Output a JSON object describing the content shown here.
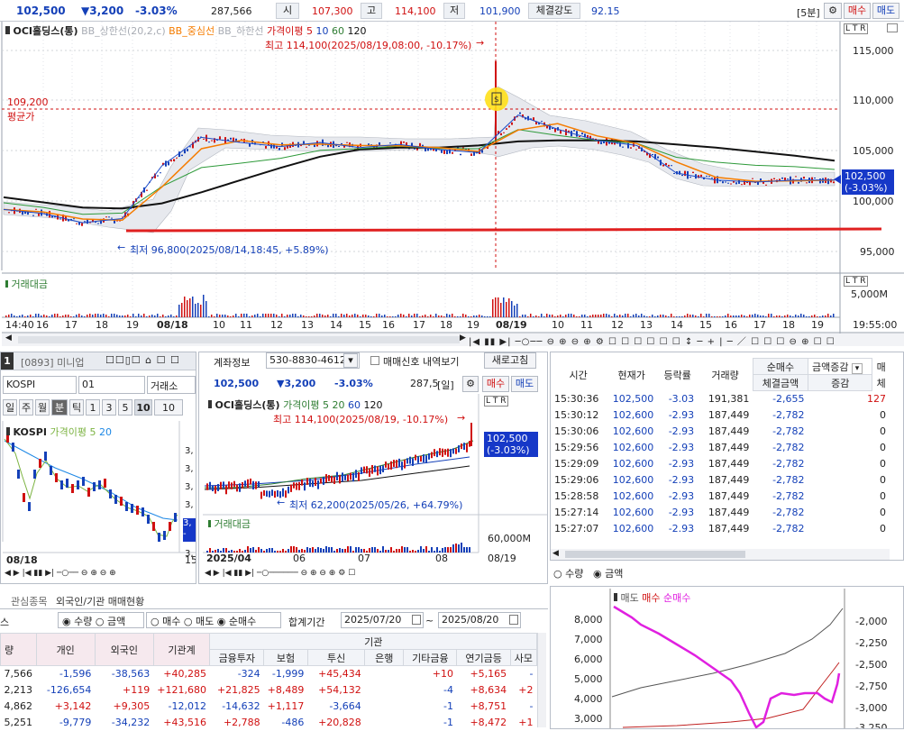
{
  "top": {
    "price": "102,500",
    "change": "▼3,200",
    "pct": "-3.03%",
    "volume": "287,566",
    "open_lbl": "시",
    "open": "107,300",
    "high_lbl": "고",
    "high": "114,100",
    "low_lbl": "저",
    "low": "101,900",
    "strength_lbl": "체결강도",
    "strength": "92.15",
    "period": "[5분]",
    "buy": "매수",
    "sell": "매도"
  },
  "main_chart": {
    "legend_name": "OCI홀딩스(통)",
    "legend_bb_up": "BB_상한선(20,2,c)",
    "legend_bb_mid": "BB_중심선",
    "legend_bb_low": "BB_하한선",
    "legend_ma": "가격이평 5",
    "legend_10": "10",
    "legend_60": "60",
    "legend_120": "120",
    "hi_ann": "최고 114,100(2025/08/19,08:00, -10.17%)",
    "lo_ann": "최저 96,800(2025/08/14,18:45, +5.89%)",
    "avg_price": "109,200",
    "avg_label": "평균가",
    "cur_price": "102,500",
    "cur_pct": "(-3.03%)",
    "y_ticks": [
      "115,000",
      "110,000",
      "105,000",
      "100,000",
      "95,000"
    ],
    "vol_label": "거래대금",
    "vol_tick": "5,000M",
    "x_ticks": [
      "14:40",
      "16",
      "17",
      "18",
      "19",
      "08/18",
      "10",
      "11",
      "12",
      "13",
      "14",
      "15",
      "16",
      "17",
      "18",
      "19",
      "08/19",
      "10",
      "11",
      "12",
      "13",
      "14",
      "15",
      "16",
      "17",
      "18",
      "19",
      "19:55:00"
    ],
    "ltr": "L T R"
  },
  "chart_data": {
    "type": "line",
    "title": "OCI홀딩스(통)",
    "series": [
      {
        "name": "가격이평 5",
        "values": [
          99.5,
          99.1,
          98.2,
          98.6,
          103.8,
          106.6,
          106.1,
          105.7,
          106.1,
          105.6,
          105.9,
          105.4,
          105.1,
          108.8,
          107.4,
          106.3,
          105.8,
          103.1,
          102.4,
          102.2,
          102.4,
          102.4
        ]
      },
      {
        "name": "120",
        "values": [
          100.7,
          100.2,
          99.7,
          99.6,
          100.1,
          101.2,
          102.4,
          103.6,
          104.7,
          105.4,
          105.6,
          105.6,
          105.8,
          106.2,
          106.3,
          106.3,
          106.2,
          105.9,
          105.6,
          105.2,
          104.8,
          104.3
        ]
      }
    ],
    "ylim": [
      93.5,
      118
    ]
  },
  "mini": {
    "tab_num": "1",
    "code": "[0893] 미니업",
    "index": "KOSPI",
    "field_code": "01",
    "exchange": "거래소",
    "periods": [
      "일",
      "주",
      "월",
      "분",
      "틱",
      "1",
      "3",
      "5",
      "10"
    ],
    "period_sel": "10",
    "legend": "KOSPI",
    "legend_ma": "가격이평 5",
    "legend_20": "20",
    "date": "08/18",
    "right_num": "15",
    "price_box_a": "3,",
    "price_box_b": "-",
    "yticks": [
      "3,",
      "3,",
      "3,",
      "3,",
      "3,",
      "3,"
    ]
  },
  "mid": {
    "acct_lbl": "계좌정보",
    "acct_no": "530-8830-4612-",
    "signal_lbl": "매매신호 내역보기",
    "refresh": "새로고침",
    "price": "102,500",
    "change": "▼3,200",
    "pct": "-3.03%",
    "vol": "287,5",
    "period": "[일]",
    "buy": "매수",
    "sell": "매도",
    "legend_name": "OCI홀딩스(통)",
    "legend_ma": "가격이평 5",
    "legend_20": "20",
    "legend_60": "60",
    "legend_120": "120",
    "hi_ann": "최고 114,100(2025/08/19, -10.17%)",
    "lo_ann": "최저 62,200(2025/05/26, +64.79%)",
    "cur_price": "102,500",
    "cur_pct": "(-3.03%)",
    "vol_label": "거래대금",
    "vol_tick": "60,000M",
    "x_ticks": [
      "2025/04",
      "06",
      "07",
      "08",
      "08/19"
    ]
  },
  "ticks": {
    "headers": [
      "시간",
      "현재가",
      "등락률",
      "거래량",
      "순매수",
      "체결금액",
      "증감"
    ],
    "select": "금액증감",
    "extra": "매",
    "extra2": "체",
    "rows": [
      [
        "15:30:36",
        "102,500",
        "-3.03",
        "191,381",
        "-2,655",
        "127"
      ],
      [
        "15:30:12",
        "102,600",
        "-2.93",
        "187,449",
        "-2,782",
        "0"
      ],
      [
        "15:30:06",
        "102,600",
        "-2.93",
        "187,449",
        "-2,782",
        "0"
      ],
      [
        "15:29:56",
        "102,600",
        "-2.93",
        "187,449",
        "-2,782",
        "0"
      ],
      [
        "15:29:09",
        "102,600",
        "-2.93",
        "187,449",
        "-2,782",
        "0"
      ],
      [
        "15:29:06",
        "102,600",
        "-2.93",
        "187,449",
        "-2,782",
        "0"
      ],
      [
        "15:28:58",
        "102,600",
        "-2.93",
        "187,449",
        "-2,782",
        "0"
      ],
      [
        "15:27:14",
        "102,600",
        "-2.93",
        "187,449",
        "-2,782",
        "0"
      ],
      [
        "15:27:07",
        "102,600",
        "-2.93",
        "187,449",
        "-2,782",
        "0"
      ]
    ]
  },
  "flow": {
    "radio_qty": "수량",
    "radio_amt": "금액",
    "legend_sell": "매도",
    "legend_buy": "매수",
    "legend_net": "순매수",
    "left_ticks": [
      "8,000",
      "7,000",
      "6,000",
      "5,000",
      "4,000",
      "3,000"
    ],
    "right_ticks": [
      "-2,000",
      "-2,250",
      "-2,500",
      "-2,750",
      "-3,000",
      "-3,250"
    ]
  },
  "investor": {
    "tabs": [
      "관심종목",
      "외국인/기관 매매현황"
    ],
    "r_qty": "수량",
    "r_amt": "금액",
    "r_buy": "매수",
    "r_sell": "매도",
    "r_net": "순매수",
    "period_lbl": "합계기간",
    "date_from": "2025/07/20",
    "date_to": "2025/08/20",
    "left_label": "스",
    "group": "기관",
    "headers": [
      "량",
      "개인",
      "외국인",
      "기관계",
      "금융투자",
      "보험",
      "투신",
      "은행",
      "기타금융",
      "연기금등",
      "사모"
    ],
    "rows": [
      [
        "7,566",
        "-1,596",
        "-38,563",
        "+40,285",
        "-324",
        "-1,999",
        "+45,434",
        "",
        "+10",
        "+5,165",
        "-"
      ],
      [
        "2,213",
        "-126,654",
        "+119",
        "+121,680",
        "+21,825",
        "+8,489",
        "+54,132",
        "",
        "-4",
        "+8,634",
        "+2"
      ],
      [
        "4,862",
        "+3,142",
        "+9,305",
        "-12,012",
        "-14,632",
        "+1,117",
        "-3,664",
        "",
        "-1",
        "+8,751",
        "-"
      ],
      [
        "5,251",
        "-9,779",
        "-34,232",
        "+43,516",
        "+2,788",
        "-486",
        "+20,828",
        "",
        "-1",
        "+8,472",
        "+1"
      ]
    ]
  },
  "colors": {
    "up": "#d01010",
    "down": "#1440b8",
    "ma5": "#e53935",
    "ma10": "#1565c0",
    "ma60": "#2e7d32",
    "ma120": "#111111",
    "bbmid": "#f57c00",
    "support": "#e02020",
    "flow_net": "#e020e0"
  }
}
